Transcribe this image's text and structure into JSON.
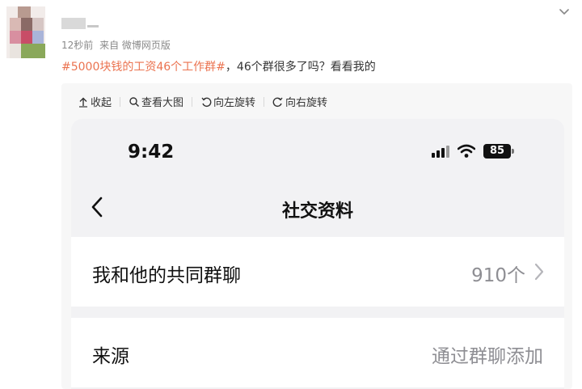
{
  "post": {
    "meta_time": "12秒前",
    "meta_source": "来自 微博网页版",
    "hashtag": "#5000块钱的工资46个工作群#",
    "text": "，46个群很多了吗？看看我的"
  },
  "toolbar": {
    "collapse_label": "收起",
    "view_large_label": "查看大图",
    "rotate_left_label": "向左旋转",
    "rotate_right_label": "向右旋转"
  },
  "phone": {
    "status_time": "9:42",
    "battery": "85",
    "nav_title": "社交资料",
    "rows": [
      {
        "label": "我和他的共同群聊",
        "value": "910个"
      },
      {
        "label": "来源",
        "value": "通过群聊添加"
      }
    ]
  },
  "colors": {
    "hashtag": "#eb7350",
    "media_background": "#f7f7f7",
    "phone_background": "#f2f2f4"
  },
  "icons": {
    "expand": "chevron-down-icon",
    "collapse": "arrow-up-icon",
    "view_large": "magnifier-icon",
    "rotate_left": "rotate-left-icon",
    "rotate_right": "rotate-right-icon",
    "signal": "signal-icon",
    "wifi": "wifi-icon",
    "battery": "battery-icon",
    "back": "back-chevron-icon",
    "row_arrow": "chevron-right-icon"
  }
}
